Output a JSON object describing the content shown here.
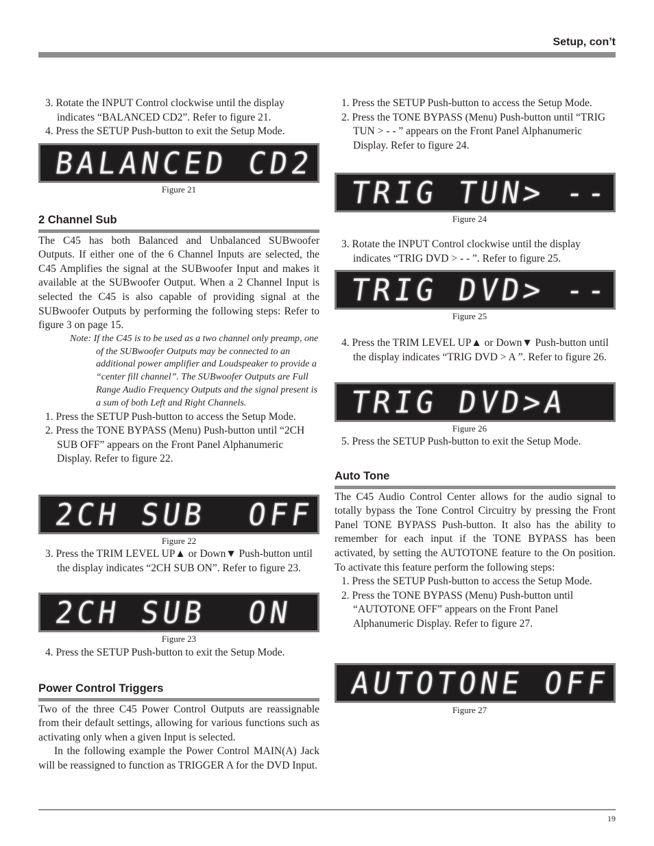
{
  "header": {
    "title": "Setup, con’t"
  },
  "left": {
    "steps_top": [
      "3. Rotate the INPUT Control clockwise until the display indicates “BALANCED CD2”. Refer to figure 21.",
      "4. Press the SETUP Push-button to exit the Setup Mode."
    ],
    "figure21": {
      "display": "BALANCED CD2",
      "caption": "Figure 21"
    },
    "two_channel_sub": {
      "heading": "2 Channel Sub",
      "body": "The C45 has both Balanced and Unbalanced SUBwoofer Outputs. If either one of the 6 Channel Inputs are selected, the C45 Amplifies the signal at the SUBwoofer Input and makes it available at the SUBwoofer Output. When a 2 Channel Input is selected the C45 is also capable of providing signal at the SUBwoofer Outputs by performing the following steps: Refer to figure 3 on page 15.",
      "note": "Note: If the C45 is to be used as a two channel only preamp, one of the SUBwoofer Outputs may be connected to an additional power amplifier and Loudspeaker to provide a “center fill channel”. The SUBwoofer Outputs are Full Range Audio Frequency Outputs and the signal present is a sum of both Left and Right Channels.",
      "steps": [
        "1. Press the SETUP Push-button to access the Setup Mode.",
        "2. Press the TONE BYPASS (Menu) Push-button until “2CH SUB OFF” appears on the Front Panel Alphanumeric Display. Refer to figure 22."
      ],
      "figure22": {
        "display": "2CH SUB  OFF",
        "caption": "Figure 22"
      },
      "step3": "3.  Press the TRIM LEVEL UP▲ or Down▼ Push-button until the display indicates “2CH SUB ON”. Refer to figure 23.",
      "figure23": {
        "display": "2CH SUB  ON",
        "caption": "Figure 23"
      },
      "step4": "4. Press the SETUP Push-button to exit the Setup Mode."
    },
    "power_control": {
      "heading": "Power Control Triggers",
      "body1": "Two of the three C45 Power Control Outputs are reassignable from their default settings, allowing for various functions such as activating only when a given Input is selected.",
      "body2": "In the following example the Power Control MAIN(A) Jack will be reassigned to function as TRIGGER A for the DVD Input."
    }
  },
  "right": {
    "steps_top": [
      "1. Press the SETUP Push-button to access the Setup Mode.",
      "2. Press the TONE BYPASS (Menu) Push-button until “TRIG TUN > - - ” appears on the Front Panel Alphanumeric Display. Refer to figure 24."
    ],
    "figure24": {
      "display": "TRIG TUN> --",
      "caption": "Figure 24"
    },
    "step3": "3. Rotate the INPUT Control clockwise until the display indicates “TRIG DVD > - - ”. Refer to figure 25.",
    "figure25": {
      "display": "TRIG DVD> --",
      "caption": "Figure 25"
    },
    "step4": "4. Press the TRIM LEVEL UP▲ or Down▼ Push-button until the display indicates “TRIG DVD > A ”. Refer to figure 26.",
    "figure26": {
      "display": "TRIG DVD>A",
      "caption": "Figure 26"
    },
    "step5": "5. Press the SETUP Push-button to exit the Setup Mode.",
    "auto_tone": {
      "heading": "Auto Tone",
      "body": "The C45 Audio Control Center allows for the audio signal to totally bypass the Tone Control Circuitry by pressing the Front Panel TONE BYPASS Push-button. It also has the ability to remember for each input if the TONE BYPASS has been activated, by setting the AUTOTONE feature to the On position. To activate this feature perform the following steps:",
      "steps": [
        "1. Press the SETUP Push-button to access the Setup Mode.",
        "2. Press the TONE BYPASS (Menu) Push-button until “AUTOTONE  OFF” appears on the Front Panel Alphanumeric Display. Refer to figure 27."
      ],
      "figure27": {
        "display": "AUTOTONE OFF",
        "caption": "Figure 27"
      }
    }
  },
  "footer": {
    "page_number": "19"
  }
}
